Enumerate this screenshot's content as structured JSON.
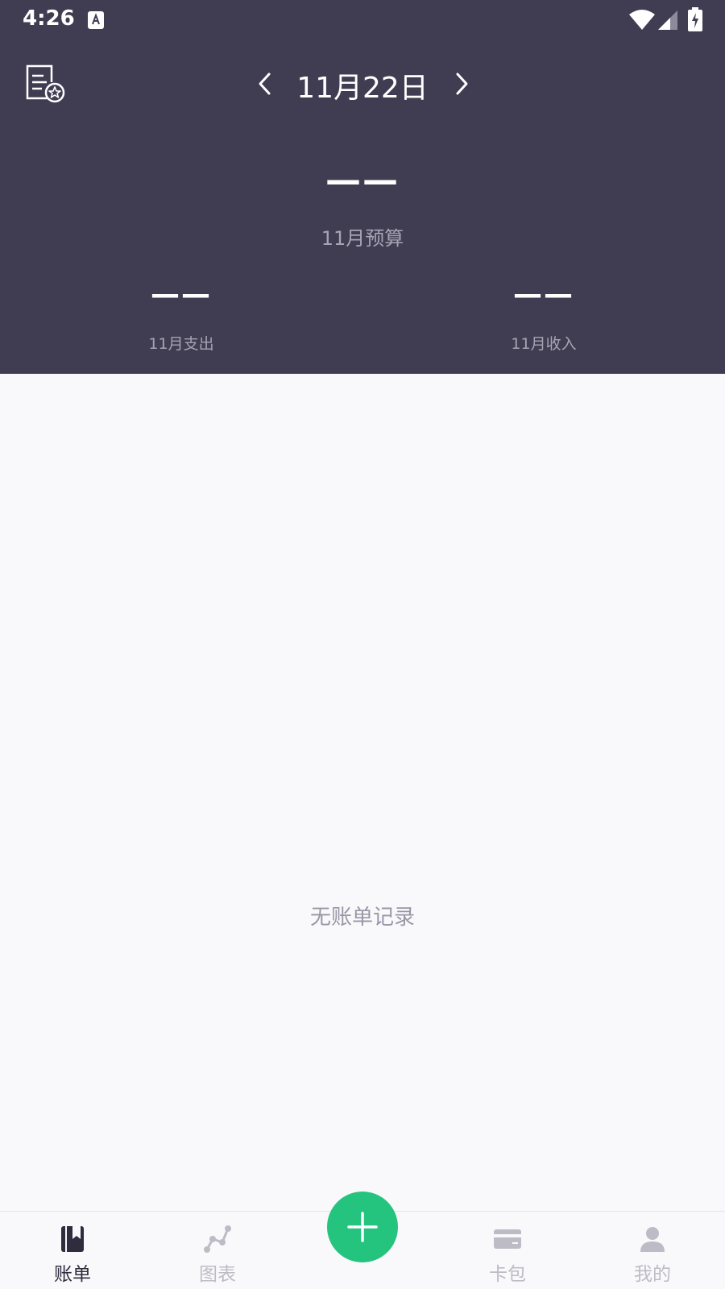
{
  "status_bar": {
    "time": "4:26",
    "icons": [
      "keyboard-a-icon",
      "wifi-icon",
      "signal-icon",
      "battery-charging-icon"
    ]
  },
  "header": {
    "date_title": "11月22日",
    "budget_value": "——",
    "budget_label": "11月预算",
    "expense_value": "——",
    "expense_label": "11月支出",
    "income_value": "——",
    "income_label": "11月收入",
    "icons": [
      "bill-star-icon",
      "chevron-left-icon",
      "chevron-right-icon"
    ]
  },
  "main": {
    "empty_text": "无账单记录"
  },
  "bottom_nav": {
    "items": [
      {
        "label": "账单",
        "icon": "book-icon",
        "active": true
      },
      {
        "label": "图表",
        "icon": "chart-icon",
        "active": false
      },
      {
        "label": "卡包",
        "icon": "card-icon",
        "active": false
      },
      {
        "label": "我的",
        "icon": "person-icon",
        "active": false
      }
    ],
    "add_icon": "plus-icon"
  },
  "colors": {
    "header_bg": "#403d52",
    "accent": "#24c47f",
    "page_bg": "#f9f9fb",
    "muted_text": "#a6a3b4",
    "inactive_nav": "#bdbcc6",
    "active_nav": "#2f2c3d"
  }
}
